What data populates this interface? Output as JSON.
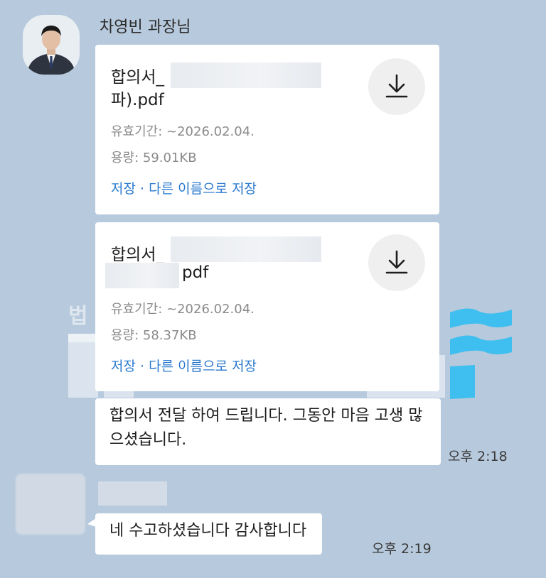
{
  "chat": {
    "sender_name": "차영빈 과장님",
    "files": [
      {
        "name_line1": "합의서_",
        "name_line2": "파).pdf",
        "expiry": "유효기간: ~2026.02.04.",
        "size": "용량: 59.01KB",
        "save_label": "저장",
        "separator": "·",
        "save_as_label": "다른 이름으로 저장"
      },
      {
        "name_line1": "합의서_",
        "name_line2": "pdf",
        "expiry": "유효기간: ~2026.02.04.",
        "size": "용량: 58.37KB",
        "save_label": "저장",
        "separator": "·",
        "save_as_label": "다른 이름으로 저장"
      }
    ],
    "messages": [
      {
        "text": "합의서 전달 하여 드립니다. 그동안 마음 고생 많으셨습니다.",
        "time": "오후 2:18"
      },
      {
        "text": "네 수고하셨습니다 감사합니다",
        "time": "오후 2:19"
      }
    ]
  },
  "watermark": {
    "text": "법"
  },
  "colors": {
    "background": "#b7c9dc",
    "link": "#2a79cf",
    "bubble": "#ffffff",
    "watermark_accent": "#3fbfef"
  },
  "icons": {
    "download": "download-icon",
    "avatar": "profile-photo"
  }
}
